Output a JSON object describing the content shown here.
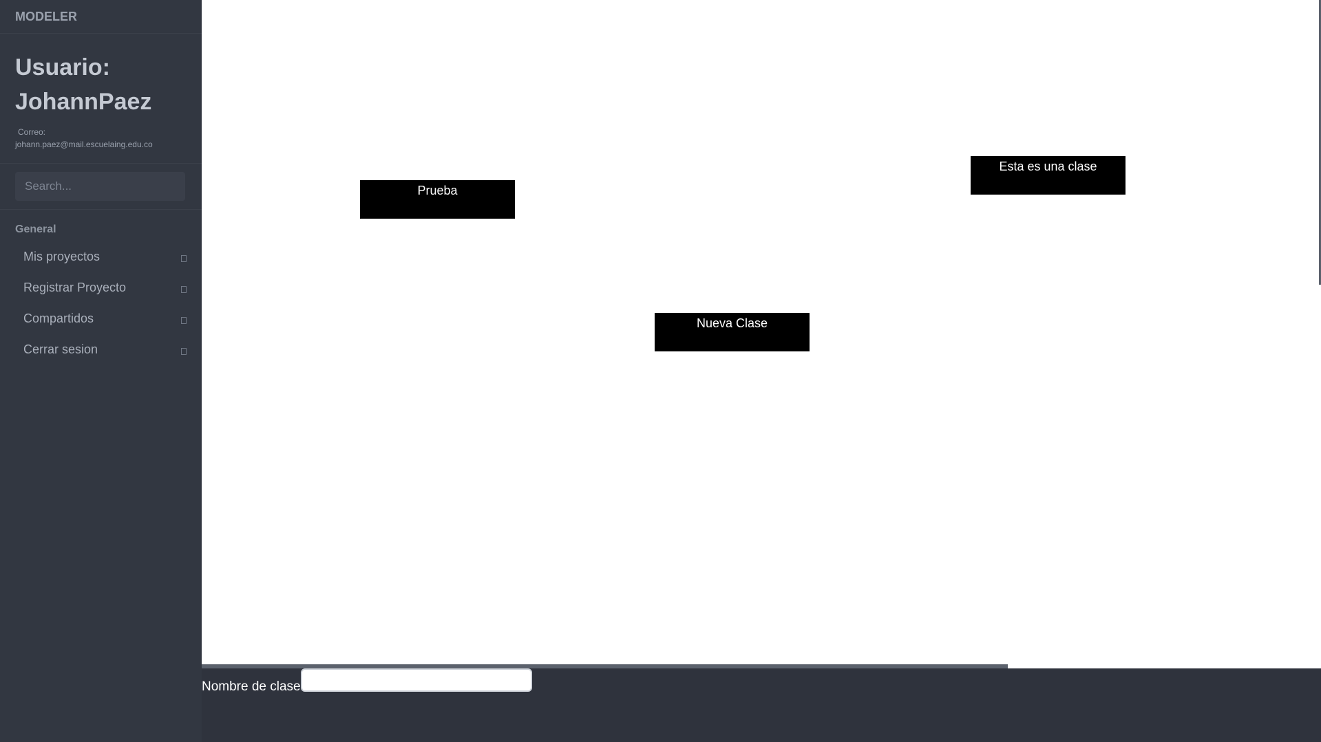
{
  "sidebar": {
    "brand": "MODELER",
    "user_title": "Usuario: JohannPaez",
    "mail_label": "Correo:",
    "mail": "johann.paez@mail.escuelaing.edu.co",
    "search": {
      "placeholder": "Search..."
    },
    "section_label": "General",
    "items": [
      {
        "label": "Mis proyectos",
        "icon": "box-icon"
      },
      {
        "label": "Registrar Proyecto",
        "icon": "box-icon"
      },
      {
        "label": "Compartidos",
        "icon": "box-icon"
      },
      {
        "label": "Cerrar sesion",
        "icon": "box-icon"
      }
    ]
  },
  "canvas": {
    "classes": [
      {
        "name": "Prueba"
      },
      {
        "name": "Esta es una clase"
      },
      {
        "name": "Nueva Clase"
      }
    ]
  },
  "bottom": {
    "class_name_label": "Nombre de clase:",
    "class_name_value": ""
  },
  "colors": {
    "sidebar_bg": "#323741",
    "canvas_bg": "#ffffff",
    "class_box_bg": "#000000",
    "bottom_bg": "#2f333d"
  }
}
